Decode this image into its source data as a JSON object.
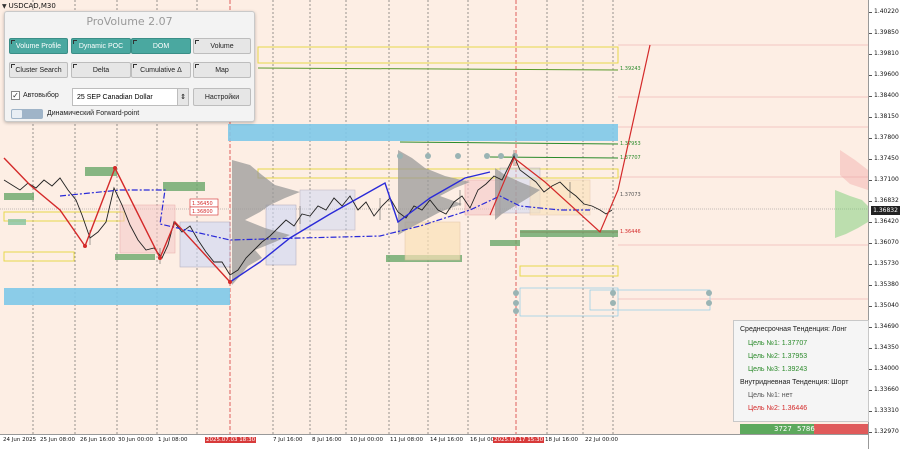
{
  "symbol": "USDCAD,M30",
  "panel": {
    "title": "ProVolume 2.07",
    "buttons": {
      "volume_profile": "Volume Profile",
      "dynamic_poc": "Dynamic POC",
      "dom": "DOM",
      "volume": "Volume",
      "cluster_search": "Cluster Search",
      "delta": "Delta",
      "cumulative_delta": "Cumulative Δ",
      "map": "Map"
    },
    "autoselect_label": "Автовыбор",
    "autoselect_checked": true,
    "instrument": "25 SEP Canadian Dollar",
    "settings_label": "Настройки",
    "forward_point_label": "Динамический Forward-point"
  },
  "price_axis": [
    "1.40220",
    "1.39850",
    "1.39810",
    "1.39600",
    "1.38400",
    "1.38150",
    "1.37800",
    "1.37450",
    "1.37100",
    "1.36832",
    "1.36420",
    "1.36070",
    "1.35730",
    "1.35380",
    "1.35040",
    "1.34690",
    "1.34350",
    "1.34000",
    "1.33660",
    "1.33310",
    "1.32970"
  ],
  "current_price": "1.36832",
  "level_labels": {
    "l1": "1.39243",
    "l2": "1.37953",
    "l3": "1.37707",
    "l4": "1.37073",
    "l5": "1.36446",
    "box1": "1.36450",
    "box2": "1.36800"
  },
  "time_axis": [
    {
      "label": "24 Jun 2025",
      "hl": false
    },
    {
      "label": "25 Jun 08:00",
      "hl": false
    },
    {
      "label": "26 Jun 16:00",
      "hl": false
    },
    {
      "label": "30 Jun 00:00",
      "hl": false
    },
    {
      "label": "1 Jul 08:00",
      "hl": false
    },
    {
      "label": "2 Jul 16:00",
      "hl": false
    },
    {
      "label": "2025.07.03 18:30",
      "hl": true
    },
    {
      "label": "7 Jul 16:00",
      "hl": false
    },
    {
      "label": "8 Jul 16:00",
      "hl": false
    },
    {
      "label": "10 Jul 00:00",
      "hl": false
    },
    {
      "label": "11 Jul 08:00",
      "hl": false
    },
    {
      "label": "14 Jul 16:00",
      "hl": false
    },
    {
      "label": "16 Jul 00:00",
      "hl": false
    },
    {
      "label": "2025.07.17 15:30",
      "hl": true
    },
    {
      "label": "18 Jul 16:00",
      "hl": false
    },
    {
      "label": "22 Jul 00:00",
      "hl": false
    }
  ],
  "trend_box": {
    "mid_title": "Среднесрочная Тенденция: Лонг",
    "mid_targets": [
      "Цель №1: 1.37707",
      "Цель №2: 1.37953",
      "Цель №3: 1.39243"
    ],
    "intraday_title": "Внутридневная Тенденция: Шорт",
    "intraday_targets": [
      "Цель №1: нет",
      "Цель №2: 1.36446"
    ]
  },
  "volume_bar": {
    "buy": "3727",
    "sell": "5786"
  },
  "colors": {
    "background": "#fdeee4",
    "accent": "#4aa8a0",
    "bull_line": "#2a2ad8",
    "bear_line": "#d42a2a",
    "band": "#7ec8e8"
  }
}
